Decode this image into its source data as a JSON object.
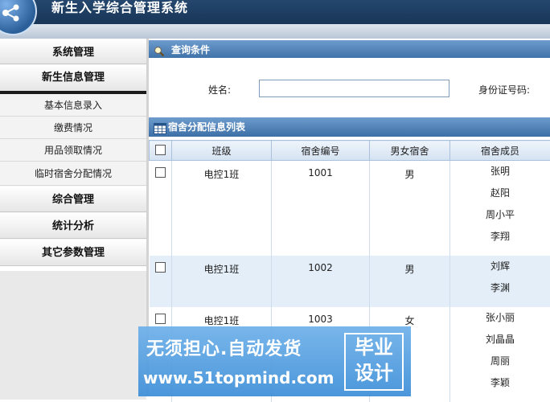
{
  "app": {
    "title": "新生入学综合管理系统"
  },
  "sidebar": {
    "groups": [
      {
        "label": "系统管理"
      },
      {
        "label": "新生信息管理",
        "items": [
          "基本信息录入",
          "缴费情况",
          "用品领取情况",
          "临时宿舍分配情况"
        ]
      },
      {
        "label": "综合管理"
      },
      {
        "label": "统计分析"
      },
      {
        "label": "其它参数管理"
      }
    ]
  },
  "query": {
    "title": "查询条件",
    "name_label": "姓名:",
    "name_value": "",
    "id_label": "身份证号码:"
  },
  "list": {
    "title": "宿舍分配信息列表",
    "columns": [
      "班级",
      "宿舍编号",
      "男女宿舍",
      "宿舍成员"
    ],
    "rows": [
      {
        "class": "电控1班",
        "dorm": "1001",
        "gender": "男",
        "members": [
          "张明",
          "赵阳",
          "周小平",
          "李翔"
        ]
      },
      {
        "class": "电控1班",
        "dorm": "1002",
        "gender": "男",
        "members": [
          "刘辉",
          "李渊"
        ]
      },
      {
        "class": "电控1班",
        "dorm": "1003",
        "gender": "女",
        "members": [
          "张小丽",
          "刘晶晶",
          "周丽",
          "李颖"
        ]
      }
    ]
  },
  "watermark": {
    "line1": "无须担心.自动发货",
    "line2": "www.51topmind.com",
    "badge_top": "毕业",
    "badge_bottom": "设计"
  }
}
